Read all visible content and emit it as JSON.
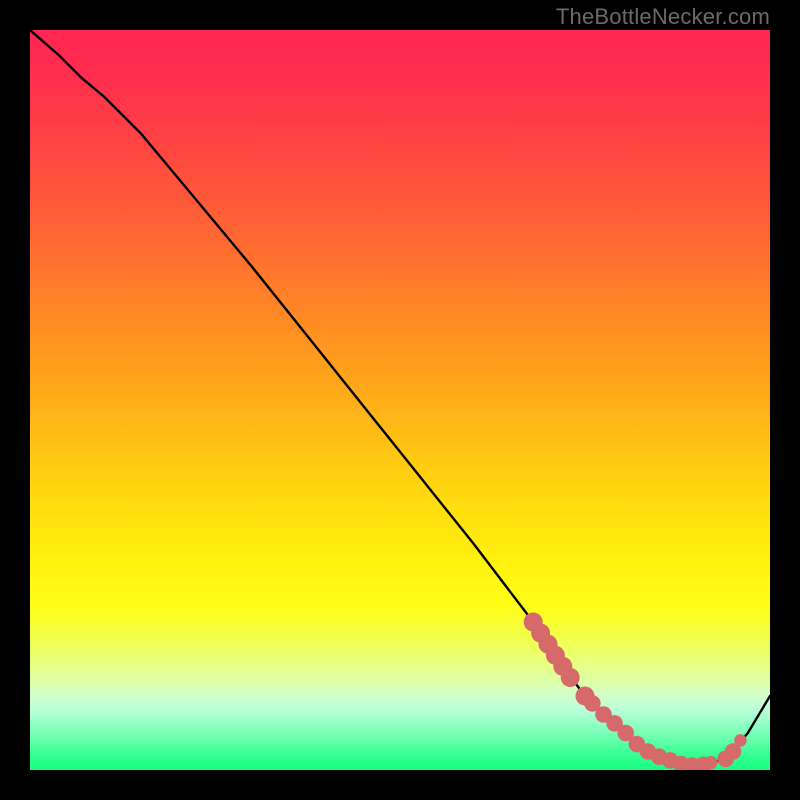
{
  "watermark": "TheBottleNecker.com",
  "colors": {
    "frame": "#000000",
    "curve": "#000000",
    "marker_fill": "#d66a6b",
    "marker_stroke": "#d66a6b"
  },
  "chart_data": {
    "type": "line",
    "title": "",
    "xlabel": "",
    "ylabel": "",
    "xlim": [
      0,
      100
    ],
    "ylim": [
      0,
      100
    ],
    "grid": false,
    "legend": false,
    "series": [
      {
        "name": "curve",
        "x": [
          0,
          4,
          7,
          10,
          15,
          20,
          30,
          40,
          50,
          60,
          68,
          72,
          75,
          78,
          82,
          86,
          90,
          94,
          97,
          100
        ],
        "y": [
          100,
          96.5,
          93.5,
          91,
          86,
          80,
          68,
          55.5,
          43,
          30.5,
          20,
          14,
          10,
          7,
          3.5,
          1.5,
          0.5,
          1.5,
          5,
          10
        ]
      }
    ],
    "markers": [
      {
        "x": 68,
        "y": 20,
        "r": 1.6
      },
      {
        "x": 69,
        "y": 18.5,
        "r": 1.6
      },
      {
        "x": 70,
        "y": 17,
        "r": 1.6
      },
      {
        "x": 71,
        "y": 15.5,
        "r": 1.6
      },
      {
        "x": 72,
        "y": 14,
        "r": 1.6
      },
      {
        "x": 73,
        "y": 12.5,
        "r": 1.6
      },
      {
        "x": 75,
        "y": 10,
        "r": 1.6
      },
      {
        "x": 76,
        "y": 9,
        "r": 1.3
      },
      {
        "x": 77.5,
        "y": 7.5,
        "r": 1.3
      },
      {
        "x": 79,
        "y": 6.3,
        "r": 1.3
      },
      {
        "x": 80.5,
        "y": 5,
        "r": 1.3
      },
      {
        "x": 82,
        "y": 3.5,
        "r": 1.3
      },
      {
        "x": 83.5,
        "y": 2.5,
        "r": 1.3
      },
      {
        "x": 85,
        "y": 1.8,
        "r": 1.3
      },
      {
        "x": 86.5,
        "y": 1.3,
        "r": 1.3
      },
      {
        "x": 88,
        "y": 0.8,
        "r": 1.3
      },
      {
        "x": 89.5,
        "y": 0.6,
        "r": 1.3
      },
      {
        "x": 91,
        "y": 0.7,
        "r": 1.3
      },
      {
        "x": 92,
        "y": 1,
        "r": 0.9
      },
      {
        "x": 94,
        "y": 1.5,
        "r": 1.3
      },
      {
        "x": 95,
        "y": 2.5,
        "r": 1.3
      },
      {
        "x": 96,
        "y": 4,
        "r": 0.8
      }
    ]
  }
}
